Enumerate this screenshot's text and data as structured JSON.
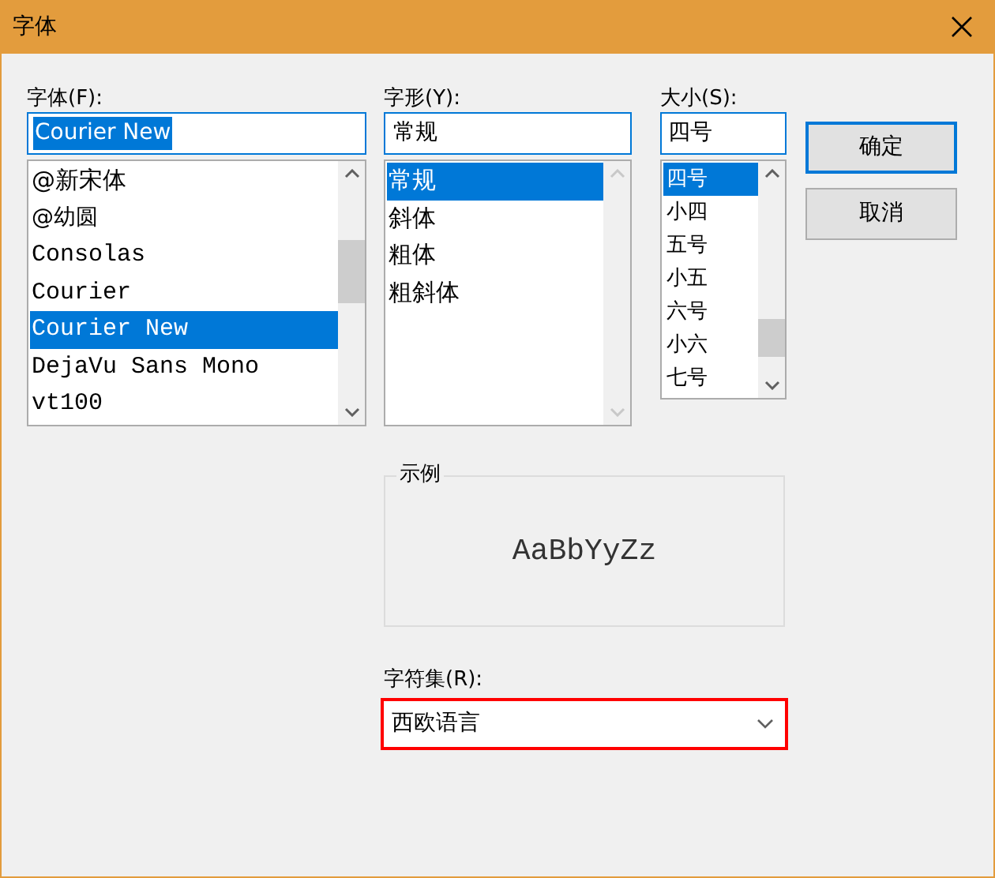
{
  "window": {
    "title": "字体"
  },
  "font": {
    "label": "字体(F):",
    "value": "Courier New",
    "items": [
      {
        "label": "@新宋体",
        "selected": false,
        "kind": "cjk"
      },
      {
        "label": "@幼圆",
        "selected": false,
        "kind": "dim"
      },
      {
        "label": "Consolas",
        "selected": false,
        "kind": "mono"
      },
      {
        "label": "Courier",
        "selected": false,
        "kind": "mono"
      },
      {
        "label": "Courier New",
        "selected": true,
        "kind": "mono"
      },
      {
        "label": "DejaVu Sans Mono",
        "selected": false,
        "kind": "mono"
      },
      {
        "label": "vt100",
        "selected": false,
        "kind": "mono"
      }
    ]
  },
  "style": {
    "label": "字形(Y):",
    "value": "常规",
    "items": [
      {
        "label": "常规",
        "selected": true
      },
      {
        "label": "斜体",
        "selected": false
      },
      {
        "label": "粗体",
        "selected": false
      },
      {
        "label": "粗斜体",
        "selected": false
      }
    ]
  },
  "size": {
    "label": "大小(S):",
    "value": "四号",
    "items": [
      {
        "label": "四号",
        "selected": true
      },
      {
        "label": "小四",
        "selected": false
      },
      {
        "label": "五号",
        "selected": false
      },
      {
        "label": "小五",
        "selected": false
      },
      {
        "label": "六号",
        "selected": false
      },
      {
        "label": "小六",
        "selected": false
      },
      {
        "label": "七号",
        "selected": false
      }
    ]
  },
  "buttons": [
    {
      "label": "确定",
      "default": true
    },
    {
      "label": "取消",
      "default": false
    }
  ],
  "sample": {
    "label": "示例",
    "text": "AaBbYyZz"
  },
  "charset": {
    "label": "字符集(R):",
    "value": "西欧语言",
    "highlighted": true
  }
}
